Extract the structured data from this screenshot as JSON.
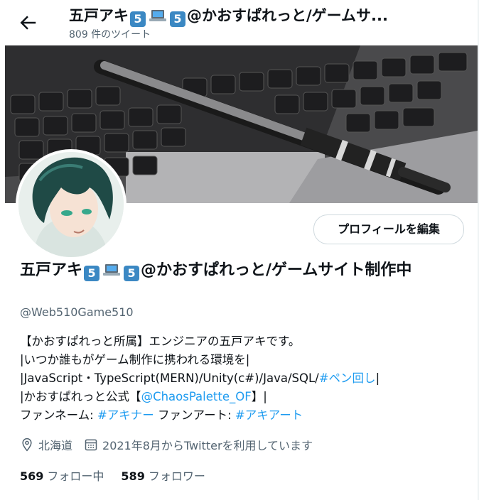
{
  "header": {
    "name_part1": "五戸アキ",
    "name_part2": "@かおすぱれっと/ゲームサ...",
    "tweet_count": "809 件のツイート"
  },
  "emoji": {
    "five": "5",
    "laptop": "laptop-icon"
  },
  "profile": {
    "name_part1": "五戸アキ",
    "name_part2": "@かおすぱれっと/ゲームサイト制作中",
    "handle": "@Web510Game510",
    "edit_button": "プロフィールを編集"
  },
  "bio": {
    "line1": "【かおすぱれっと所属】エンジニアの五戸アキです。",
    "line2": "|いつか誰もがゲーム制作に携われる環境を|",
    "line3_prefix": "|JavaScript・TypeScript(MERN)/Unity(c#)/Java/SQL/",
    "line3_tag": "#ペン回し",
    "line3_suffix": "|",
    "line4_prefix": "|かおすぱれっと公式【",
    "line4_mention": "@ChaosPalette_OF",
    "line4_suffix": "】|",
    "line5_prefix": "ファンネーム: ",
    "line5_tag1": "#アキナー",
    "line5_mid": " ファンアート: ",
    "line5_tag2": "#アキアート"
  },
  "meta": {
    "location": "北海道",
    "joined": "2021年8月からTwitterを利用しています"
  },
  "stats": {
    "following_count": "569",
    "following_label": "フォロー中",
    "followers_count": "589",
    "followers_label": "フォロワー"
  },
  "colors": {
    "accent": "#1d9bf0",
    "secondary_text": "#536471",
    "emoji_box": "#3b88c3"
  }
}
